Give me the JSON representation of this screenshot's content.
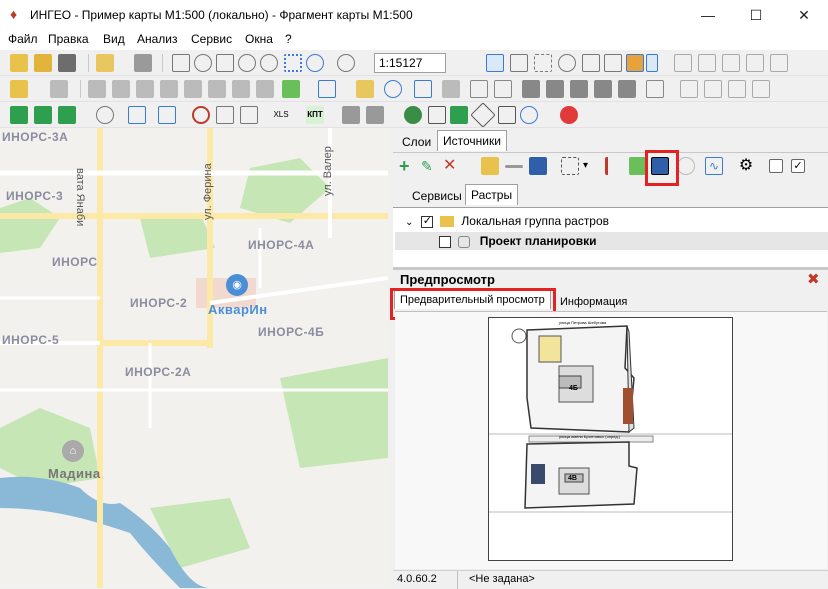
{
  "window": {
    "title": "ИНГЕО - Пример карты М1:500 (локально) - Фрагмент карты М1:500",
    "minimize": "—",
    "maximize": "☐",
    "close": "✕"
  },
  "menu": [
    "Файл",
    "Правка",
    "Вид",
    "Анализ",
    "Сервис",
    "Окна",
    "?"
  ],
  "toolbar": {
    "scale_value": "1:15127",
    "xls_label": "XLS",
    "kpt_label": "КПТ"
  },
  "map": {
    "labels": {
      "inors_3a": "ИНОРС-3А",
      "inors_3": "ИНОРС-3",
      "inors_left": "ИНОРС",
      "inors_4a": "ИНОРС-4А",
      "inors_2": "ИНОРС-2",
      "inors_4b": "ИНОРС-4Б",
      "inors_5": "ИНОРС-5",
      "inors_2a": "ИНОРС-2А",
      "akvarin": "АкварИн",
      "madina": "Мадина"
    },
    "streets": {
      "yanbi": "вата Янаби",
      "ferina": "ул. Ферина",
      "valery": "ул. Валер"
    }
  },
  "panel": {
    "top_tabs": {
      "layers": "Слои",
      "sources": "Источники"
    },
    "sub_tabs": {
      "services": "Сервисы",
      "rasters": "Растры"
    },
    "tree": {
      "group": "Локальная группа растров",
      "project": "Проект планировки"
    }
  },
  "preview": {
    "title": "Предпросмотр",
    "tab_preview": "Предварительный просмотр",
    "tab_info": "Информация",
    "map_labels": {
      "block1": "4Б",
      "block2": "4В",
      "street1": "улица Петрова Шебутова",
      "street2": "улица имени Бронтовых (опред.)"
    }
  },
  "status": {
    "version": "4.0.60.2",
    "projection": "<Не задана>"
  },
  "colors": {
    "highlight": "#e32222",
    "map_bg": "#f2f1ee",
    "park": "#c7e6b6",
    "road": "#fce9a6",
    "water": "#8ab9d8",
    "poi": "#4a8fd6"
  }
}
